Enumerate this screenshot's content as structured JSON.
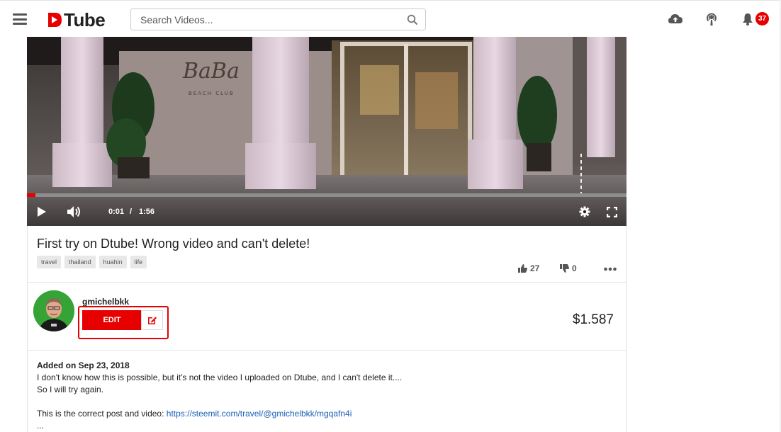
{
  "header": {
    "logo_text": "Tube",
    "search_placeholder": "Search Videos...",
    "notification_count": "37",
    "brand_color": "#e60000"
  },
  "icons": {
    "menu": "hamburger-menu-icon",
    "search": "search-icon",
    "upload": "cloud-upload-icon",
    "live": "broadcast-icon",
    "notifications": "bell-icon"
  },
  "video": {
    "current_time": "0:01",
    "separator": "/",
    "duration": "1:56",
    "progress_fraction": 0.009,
    "scene_sign": "BaBa",
    "scene_subsign": "BEACH CLUB"
  },
  "info": {
    "title": "First try on Dtube! Wrong video and can't delete!",
    "tags": [
      "travel",
      "thailand",
      "huahin",
      "life"
    ],
    "likes": "27",
    "dislikes": "0",
    "more": "•••"
  },
  "author": {
    "username": "gmichelbkk",
    "edit_label": "EDIT",
    "payout": "$1.587"
  },
  "description": {
    "added": "Added on Sep 23, 2018",
    "line1": "I don't know how this is possible, but it's not the video I uploaded on Dtube, and I can't delete it....",
    "line2": "So I will try again.",
    "line3_prefix": "This is the correct post and video: ",
    "line3_link": "https://steemit.com/travel/@gmichelbkk/mgqafn4i",
    "ellipsis": "..."
  }
}
